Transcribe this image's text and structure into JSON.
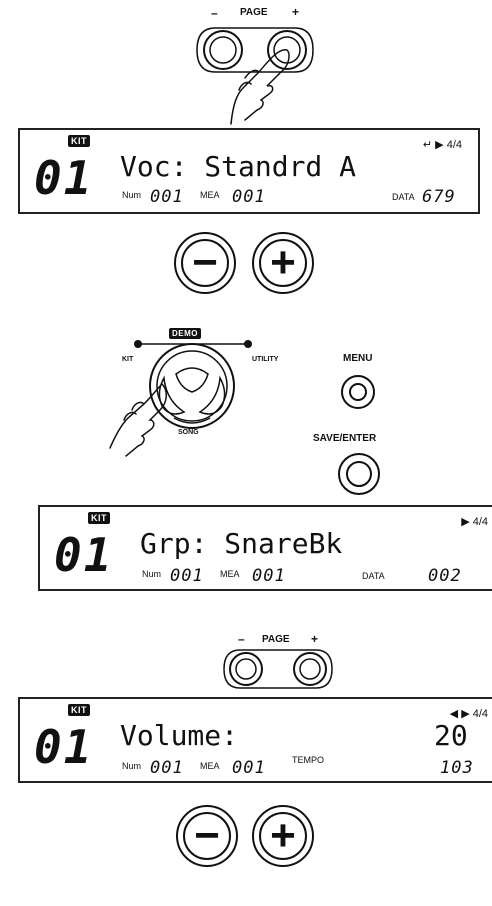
{
  "page_buttons_top": {
    "minus": "–",
    "label": "PAGE",
    "plus": "+"
  },
  "lcd1": {
    "badge": "KIT",
    "big_number": "01",
    "main_text": "Voc: Standrd A",
    "indicator": "↵ ▶ 4/4",
    "num_label": "Num",
    "num_value": "001",
    "mea_label": "MEA",
    "mea_value": "001",
    "data_label": "DATA",
    "data_value": "679"
  },
  "dial_buttons_1": {
    "minus": "−",
    "plus": "+"
  },
  "mode_selector": {
    "top": "DEMO",
    "left": "KIT",
    "right": "UTILITY",
    "bottom": "SONG"
  },
  "menu": {
    "label": "MENU"
  },
  "save_enter": {
    "label": "SAVE/ENTER"
  },
  "lcd2": {
    "badge": "KIT",
    "big_number": "01",
    "main_text": "Grp: SnareBk",
    "indicator": "▶ 4/4",
    "num_label": "Num",
    "num_value": "001",
    "mea_label": "MEA",
    "mea_value": "001",
    "data_label": "DATA",
    "data_value": "002"
  },
  "page_buttons_mid": {
    "minus": "–",
    "label": "PAGE",
    "plus": "+"
  },
  "lcd3": {
    "badge": "KIT",
    "big_number": "01",
    "main_text": "Volume:",
    "main_value": "20",
    "indicator": "◀ ▶ 4/4",
    "num_label": "Num",
    "num_value": "001",
    "mea_label": "MEA",
    "mea_value": "001",
    "tempo_label": "TEMPO",
    "tempo_value": "103"
  },
  "dial_buttons_2": {
    "minus": "−",
    "plus": "+"
  }
}
